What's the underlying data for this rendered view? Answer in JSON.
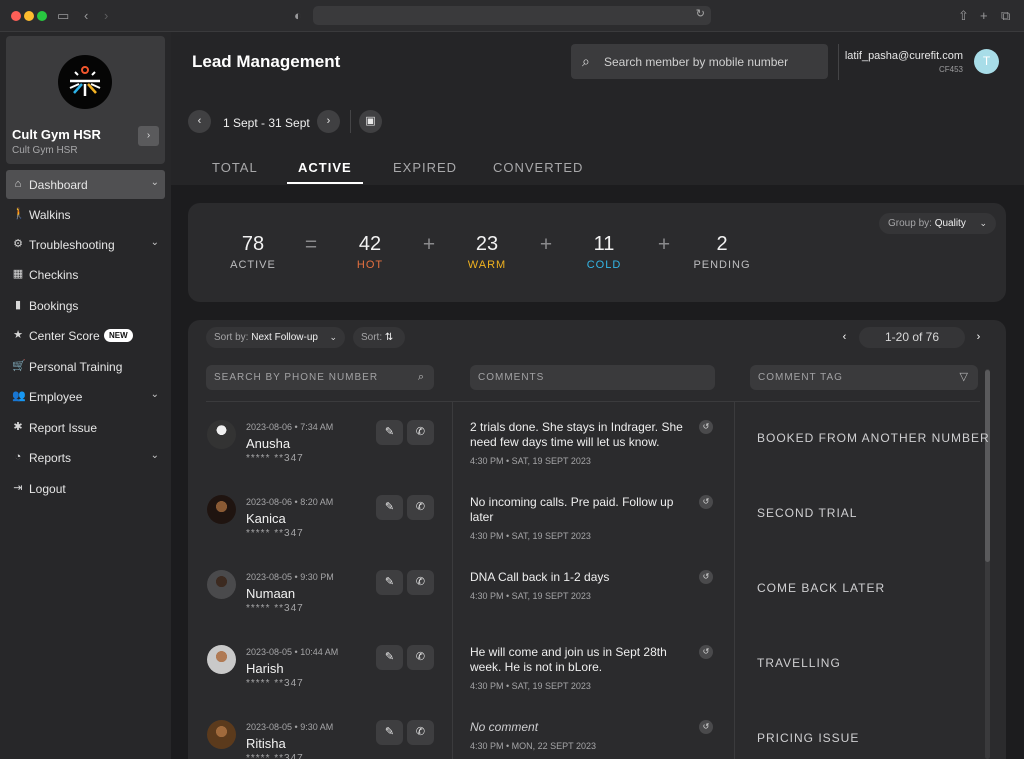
{
  "browser": {
    "reload_icon": "reload-icon"
  },
  "sidebar": {
    "brand_name": "Cult Gym HSR",
    "brand_sub": "Cult Gym HSR",
    "expand_label": "›",
    "items": [
      {
        "label": "Dashboard",
        "icon": "home-icon",
        "glyph": "⌂",
        "expandable": true,
        "active": true
      },
      {
        "label": "Walkins",
        "icon": "walking-icon",
        "glyph": "🚶",
        "expandable": false
      },
      {
        "label": "Troubleshooting",
        "icon": "gear-icon",
        "glyph": "⚙",
        "expandable": true
      },
      {
        "label": "Checkins",
        "icon": "calendar-check-icon",
        "glyph": "▦",
        "expandable": false
      },
      {
        "label": "Bookings",
        "icon": "bookmark-icon",
        "glyph": "▮",
        "expandable": false
      },
      {
        "label": "Center Score",
        "icon": "star-icon",
        "glyph": "★",
        "expandable": false,
        "badge": "NEW"
      },
      {
        "label": "Personal Training",
        "icon": "cart-icon",
        "glyph": "🛒",
        "expandable": false
      },
      {
        "label": "Employee",
        "icon": "people-icon",
        "glyph": "👥",
        "expandable": true
      },
      {
        "label": "Report Issue",
        "icon": "bug-icon",
        "glyph": "✱",
        "expandable": false
      },
      {
        "label": "Reports",
        "icon": "pie-chart-icon",
        "glyph": "◔",
        "expandable": true
      },
      {
        "label": "Logout",
        "icon": "logout-icon",
        "glyph": "⇥",
        "expandable": false
      }
    ]
  },
  "header": {
    "title": "Lead Management",
    "search_placeholder": "Search member by mobile number",
    "user_email": "latif_pasha@curefit.com",
    "user_code": "CF453",
    "user_initial": "T",
    "date_range": "1 Sept - 31 Sept",
    "tabs": [
      {
        "label": "TOTAL",
        "active": false
      },
      {
        "label": "ACTIVE",
        "active": true
      },
      {
        "label": "EXPIRED",
        "active": false
      },
      {
        "label": "CONVERTED",
        "active": false
      }
    ]
  },
  "summary": {
    "group_by_label": "Group by:",
    "group_by_value": "Quality",
    "active": {
      "value": "78",
      "label": "ACTIVE",
      "color": "#bdbdbf"
    },
    "hot": {
      "value": "42",
      "label": "HOT",
      "color": "#e5703f"
    },
    "warm": {
      "value": "23",
      "label": "WARM",
      "color": "#f0b21f"
    },
    "cold": {
      "value": "11",
      "label": "COLD",
      "color": "#33b6e6"
    },
    "pending": {
      "value": "2",
      "label": "PENDING",
      "color": "#bdbdbf"
    },
    "equals": "=",
    "plus": "+"
  },
  "table": {
    "sort_label": "Sort by:",
    "sort_value": "Next Follow-up",
    "sort_dir_label": "Sort:",
    "pager": "1-20 of 76",
    "search_phone_placeholder": "SEARCH BY PHONE NUMBER",
    "comments_header": "COMMENTS",
    "comment_tag_header": "COMMENT TAG",
    "rows": [
      {
        "date": "2023-08-06 • 7:34 AM",
        "name": "Anusha",
        "phone": "***** **347",
        "comment": "2 trials done. She stays in Indrager. She need few days time will let us know.",
        "comment_time": "4:30 PM • SAT, 19 SEPT 2023",
        "tag": "BOOKED FROM ANOTHER NUMBER"
      },
      {
        "date": "2023-08-06 • 8:20 AM",
        "name": "Kanica",
        "phone": "***** **347",
        "comment": "No incoming calls. Pre paid. Follow up later",
        "comment_time": "4:30 PM • SAT, 19 SEPT 2023",
        "tag": "SECOND TRIAL"
      },
      {
        "date": "2023-08-05 • 9:30 PM",
        "name": "Numaan",
        "phone": "***** **347",
        "comment": "DNA Call back in 1-2 days",
        "comment_time": "4:30 PM • SAT, 19 SEPT 2023",
        "tag": "COME BACK LATER"
      },
      {
        "date": "2023-08-05 • 10:44 AM",
        "name": "Harish",
        "phone": "***** **347",
        "comment": "He will come and join us in Sept 28th week. He is not in bLore.",
        "comment_time": "4:30 PM • SAT, 19 SEPT 2023",
        "tag": "TRAVELLING"
      },
      {
        "date": "2023-08-05 • 9:30 AM",
        "name": "Ritisha",
        "phone": "***** **347",
        "comment": "No comment",
        "comment_time": "4:30 PM • MON, 22 SEPT 2023",
        "tag": "PRICING ISSUE",
        "empty": true
      }
    ]
  }
}
